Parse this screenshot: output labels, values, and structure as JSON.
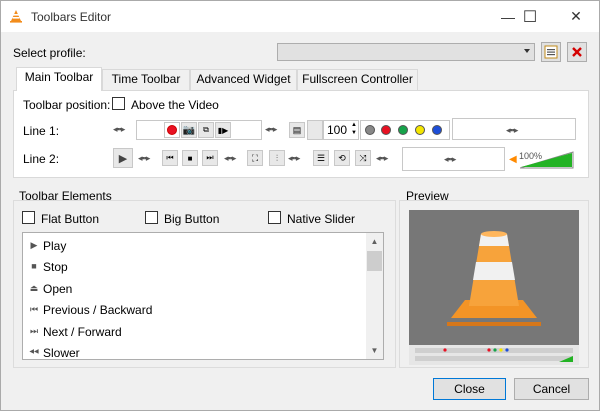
{
  "window": {
    "title": "Toolbars Editor",
    "min_glyph": "—",
    "max_glyph": "☐",
    "close_glyph": "✕"
  },
  "profile": {
    "label": "Select profile:",
    "value": ""
  },
  "tabs": [
    {
      "label": "Main Toolbar",
      "active": true
    },
    {
      "label": "Time Toolbar",
      "active": false
    },
    {
      "label": "Advanced Widget",
      "active": false
    },
    {
      "label": "Fullscreen Controller",
      "active": false
    }
  ],
  "main_toolbar": {
    "position_label": "Toolbar position:",
    "above_video_label": "Above the Video",
    "above_video_checked": false,
    "line1_label": "Line 1:",
    "line2_label": "Line 2:",
    "speed_value": "100",
    "volume_percent_text": "100%",
    "volume_level": 1.0,
    "color_buttons": [
      "#888888",
      "#e81123",
      "#16a34a",
      "#f4e600",
      "#1d4ed8"
    ]
  },
  "elements": {
    "group_label": "Toolbar Elements",
    "flat_button_label": "Flat Button",
    "big_button_label": "Big Button",
    "native_slider_label": "Native Slider",
    "items": [
      {
        "label": "Play",
        "icon": "play-icon",
        "glyph": "▶"
      },
      {
        "label": "Stop",
        "icon": "stop-icon",
        "glyph": "■"
      },
      {
        "label": "Open",
        "icon": "eject-icon",
        "glyph": "⏏"
      },
      {
        "label": "Previous / Backward",
        "icon": "previous-icon",
        "glyph": "⏮"
      },
      {
        "label": "Next / Forward",
        "icon": "next-icon",
        "glyph": "⏭"
      },
      {
        "label": "Slower",
        "icon": "slower-icon",
        "glyph": "◀◀"
      }
    ]
  },
  "preview": {
    "label": "Preview"
  },
  "buttons": {
    "close": "Close",
    "cancel": "Cancel"
  }
}
